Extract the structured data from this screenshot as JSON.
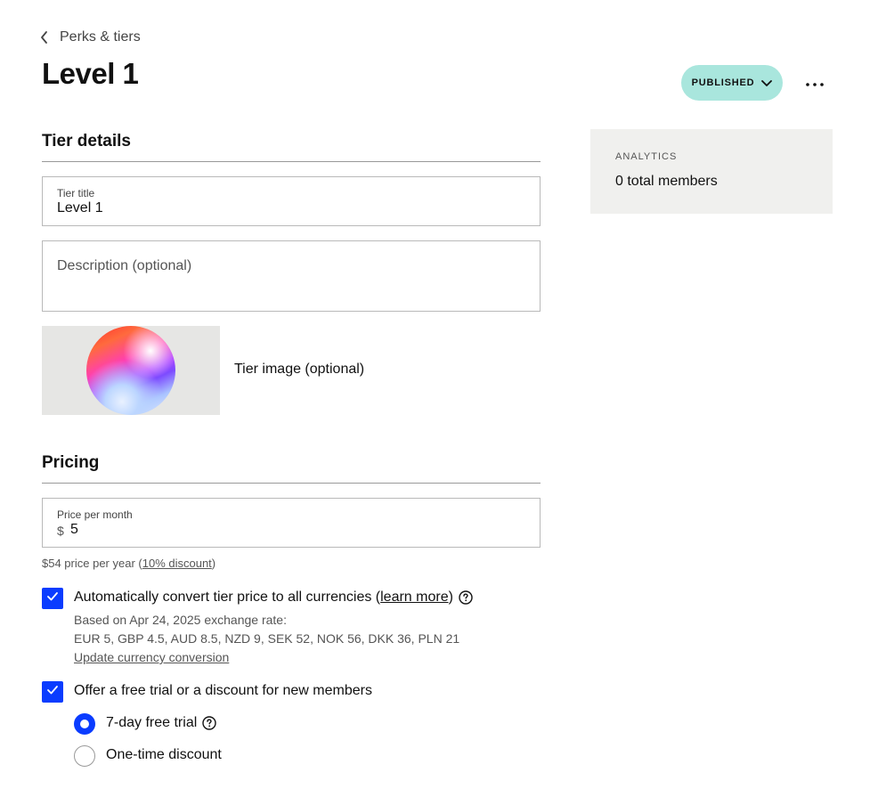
{
  "breadcrumb": {
    "label": "Perks & tiers"
  },
  "page": {
    "title": "Level 1"
  },
  "header": {
    "status_label": "PUBLISHED"
  },
  "tier_details": {
    "section_title": "Tier details",
    "title_field": {
      "label": "Tier title",
      "value": "Level 1"
    },
    "description_field": {
      "placeholder": "Description (optional)"
    },
    "image_label": "Tier image (optional)"
  },
  "analytics": {
    "caption": "ANALYTICS",
    "members": "0 total members"
  },
  "pricing": {
    "section_title": "Pricing",
    "price_field": {
      "label": "Price per month",
      "currency_symbol": "$",
      "value": "5"
    },
    "annual_prefix": "$54 price per year (",
    "annual_discount_link": "10% discount",
    "annual_suffix": ")",
    "auto_convert": {
      "label_prefix": "Automatically convert tier price to all currencies (",
      "learn_more": "learn more",
      "label_suffix": ")",
      "checked": true,
      "rate_note": "Based on Apr 24, 2025 exchange rate:",
      "rates": "EUR 5, GBP 4.5, AUD 8.5, NZD 9, SEK 52, NOK 56, DKK 36, PLN 21",
      "update_link": "Update currency conversion"
    },
    "trial": {
      "label": "Offer a free trial or a discount for new members",
      "checked": true,
      "options": [
        {
          "label": "7-day free trial",
          "selected": true
        },
        {
          "label": "One-time discount",
          "selected": false
        }
      ]
    }
  },
  "colors": {
    "accent": "#0a3cff",
    "status_bg": "#a9e6dd",
    "panel_bg": "#f0f0ee"
  },
  "icons": [
    "chevron-left-icon",
    "chevron-down-icon",
    "more-icon",
    "check-icon",
    "help-icon"
  ]
}
